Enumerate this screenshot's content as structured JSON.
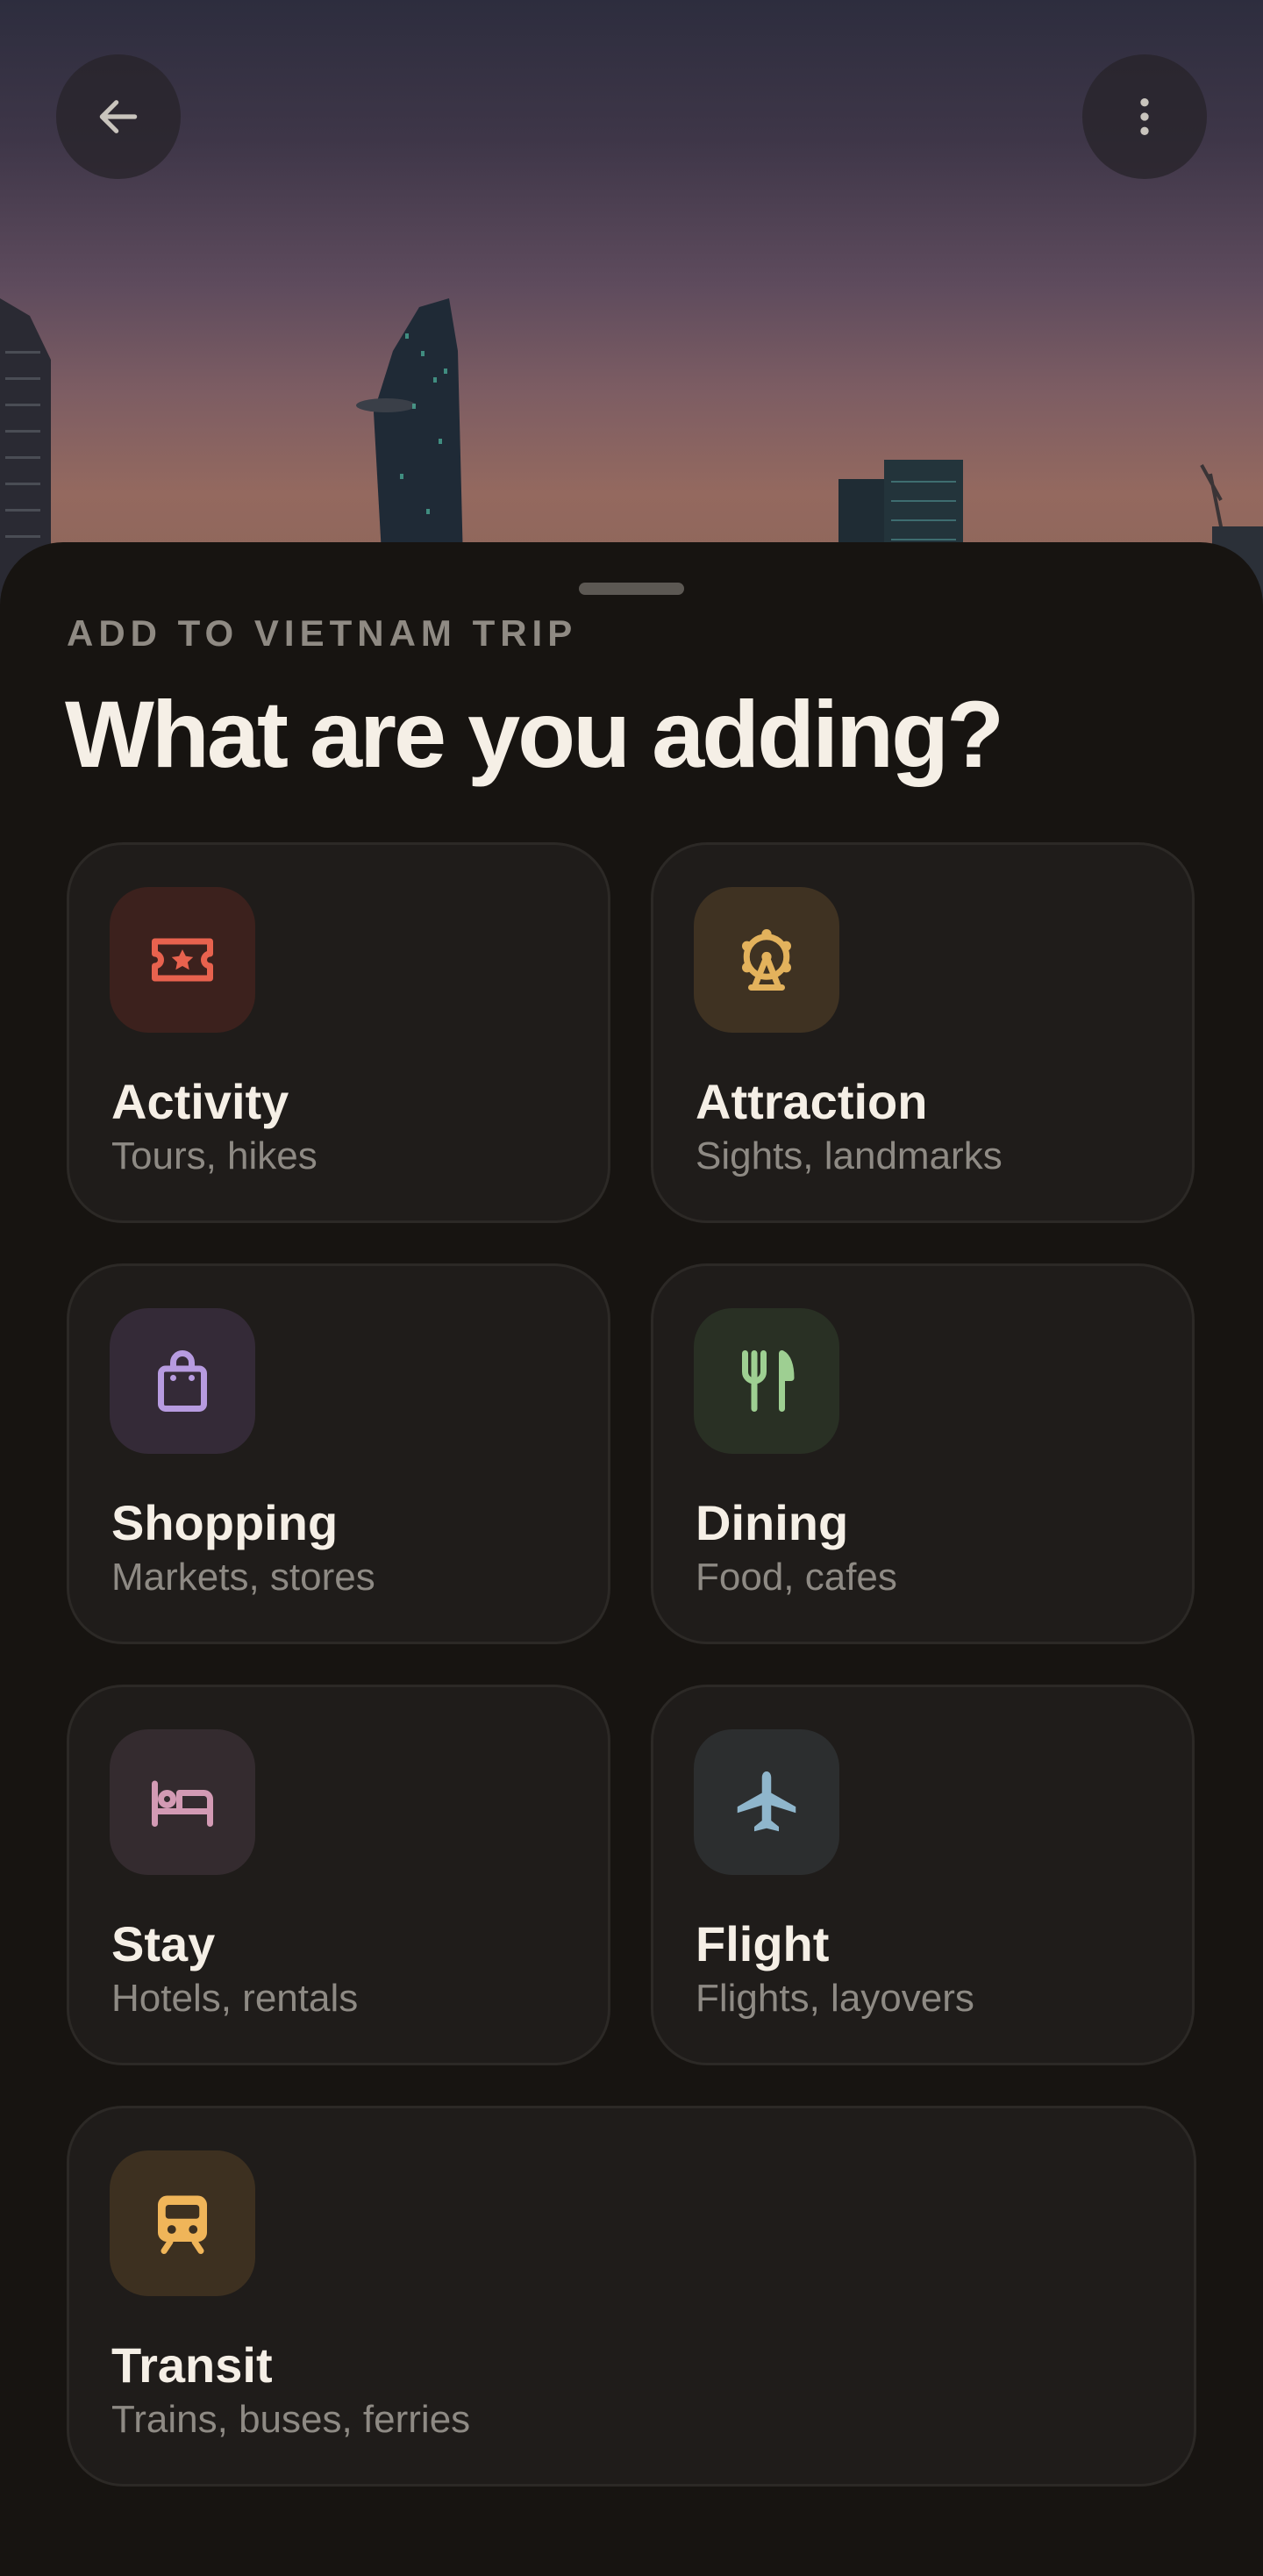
{
  "header": {
    "back_icon": "arrow-left-icon",
    "menu_icon": "more-vertical-icon",
    "hero_image": "city-skyline-at-dusk"
  },
  "sheet": {
    "eyebrow": "ADD TO VIETNAM TRIP",
    "title": "What are you adding?"
  },
  "categories": [
    {
      "title": "Activity",
      "subtitle": "Tours, hikes",
      "icon": "ticket-icon",
      "color": "#e8624e",
      "tile": "#3c211d"
    },
    {
      "title": "Attraction",
      "subtitle": "Sights, landmarks",
      "icon": "ferris-wheel-icon",
      "color": "#e3b25c",
      "tile": "#3f3222"
    },
    {
      "title": "Shopping",
      "subtitle": "Markets, stores",
      "icon": "shopping-bag-icon",
      "color": "#b79be0",
      "tile": "#342a37"
    },
    {
      "title": "Dining",
      "subtitle": "Food, cafes",
      "icon": "fork-knife-icon",
      "color": "#9ecf92",
      "tile": "#293024"
    },
    {
      "title": "Stay",
      "subtitle": "Hotels, rentals",
      "icon": "bed-icon",
      "color": "#d39ab4",
      "tile": "#342b2f"
    },
    {
      "title": "Flight",
      "subtitle": "Flights, layovers",
      "icon": "airplane-icon",
      "color": "#8fb6cc",
      "tile": "#2c2e2f"
    },
    {
      "title": "Transit",
      "subtitle": "Trains, buses, ferries",
      "icon": "train-icon",
      "color": "#f0b559",
      "tile": "#3d3020"
    }
  ]
}
